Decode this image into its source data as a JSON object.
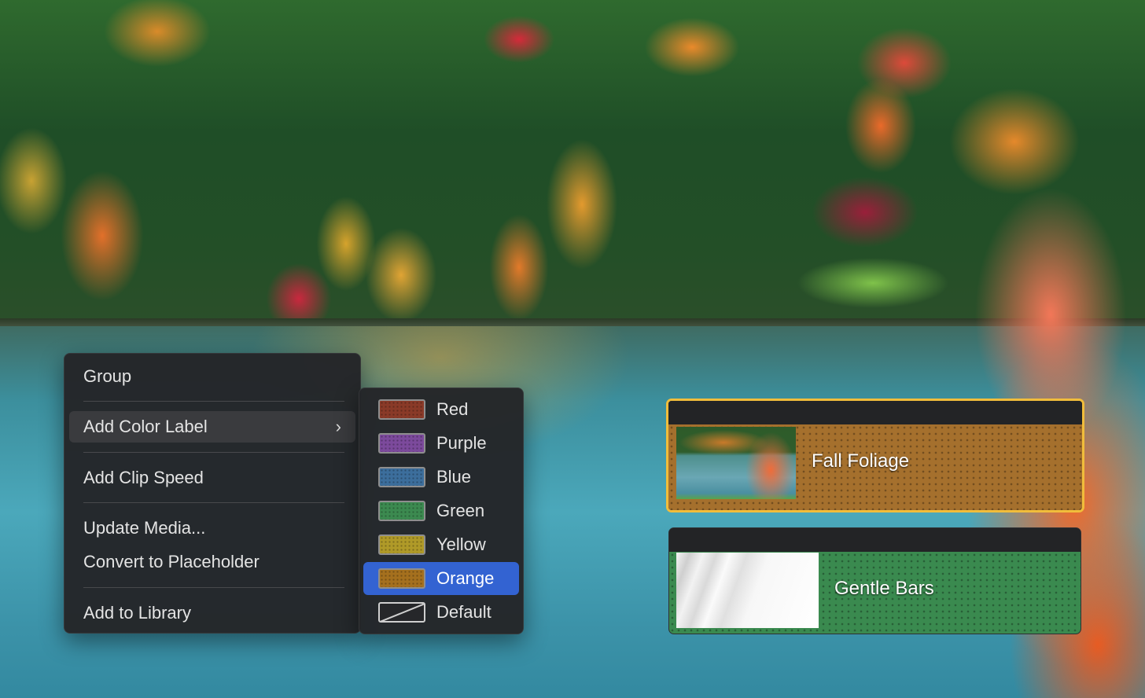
{
  "menu": {
    "items": [
      {
        "label": "Group"
      },
      {
        "label": "Add Color Label",
        "has_submenu": true,
        "highlighted": true
      },
      {
        "label": "Add Clip Speed"
      },
      {
        "label": "Update Media..."
      },
      {
        "label": "Convert to Placeholder"
      },
      {
        "label": "Add to Library"
      }
    ],
    "chevron": "›"
  },
  "submenu": {
    "items": [
      {
        "label": "Red",
        "color": "#8a3a28"
      },
      {
        "label": "Purple",
        "color": "#7c4a9c"
      },
      {
        "label": "Blue",
        "color": "#3c6e9c"
      },
      {
        "label": "Green",
        "color": "#3c8a50"
      },
      {
        "label": "Yellow",
        "color": "#b09a28"
      },
      {
        "label": "Orange",
        "color": "#a5701e",
        "selected": true
      },
      {
        "label": "Default",
        "color": "none"
      }
    ]
  },
  "clips": [
    {
      "title": "Fall Foliage",
      "color": "#a5702d",
      "selected": true,
      "selection_color": "#f1bd3b"
    },
    {
      "title": "Gentle Bars",
      "color": "#3a8a4f",
      "selected": false
    }
  ]
}
